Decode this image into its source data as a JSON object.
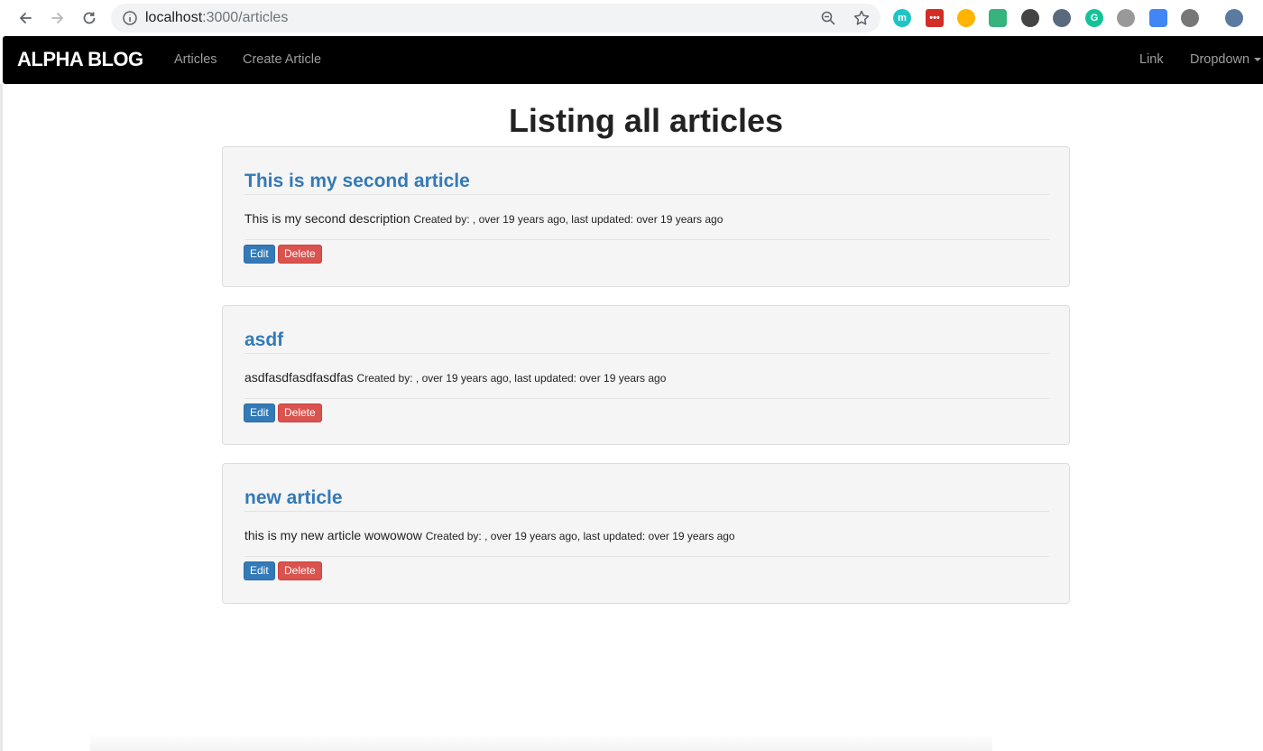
{
  "browser": {
    "url_host": "localhost",
    "url_path": ":3000/articles",
    "extensions": [
      {
        "icon": "mercury-icon",
        "glyph": "m",
        "color": "#20c4c4"
      },
      {
        "icon": "lastpass-icon",
        "glyph": "•••",
        "color": "#d32d27"
      },
      {
        "icon": "color-picker-icon",
        "glyph": "",
        "color": "#ffb400"
      },
      {
        "icon": "screen-capture-icon",
        "glyph": "",
        "color": "#36b37e"
      },
      {
        "icon": "dark-reader-icon",
        "glyph": "",
        "color": "#444444"
      },
      {
        "icon": "privacy-badger-icon",
        "glyph": "",
        "color": "#5a6a7e"
      },
      {
        "icon": "grammarly-icon",
        "glyph": "G",
        "color": "#15c39a"
      },
      {
        "icon": "power-icon",
        "glyph": "",
        "color": "#999999"
      },
      {
        "icon": "bracket-extension-icon",
        "glyph": "",
        "color": "#4285f4"
      },
      {
        "icon": "puzzle-extension-icon",
        "glyph": "",
        "color": "#777777"
      },
      {
        "icon": "profile-avatar-icon",
        "glyph": "",
        "color": "#5b7aa0"
      }
    ]
  },
  "navbar": {
    "brand": "ALPHA BLOG",
    "links": [
      "Articles",
      "Create Article"
    ],
    "right_links": [
      "Link",
      "Dropdown"
    ]
  },
  "page": {
    "title": "Listing all articles"
  },
  "articles": [
    {
      "title": "This is my second article",
      "description": "This is my second description",
      "meta": "Created by: , over 19 years ago, last updated: over 19 years ago",
      "edit_label": "Edit",
      "delete_label": "Delete"
    },
    {
      "title": "asdf",
      "description": "asdfasdfasdfasdfas",
      "meta": "Created by: , over 19 years ago, last updated: over 19 years ago",
      "edit_label": "Edit",
      "delete_label": "Delete"
    },
    {
      "title": "new article",
      "description": "this is my new article wowowow",
      "meta": "Created by: , over 19 years ago, last updated: over 19 years ago",
      "edit_label": "Edit",
      "delete_label": "Delete"
    }
  ],
  "colors": {
    "navbar_bg": "#000000",
    "link_blue": "#337ab7",
    "danger_red": "#d9534f"
  }
}
